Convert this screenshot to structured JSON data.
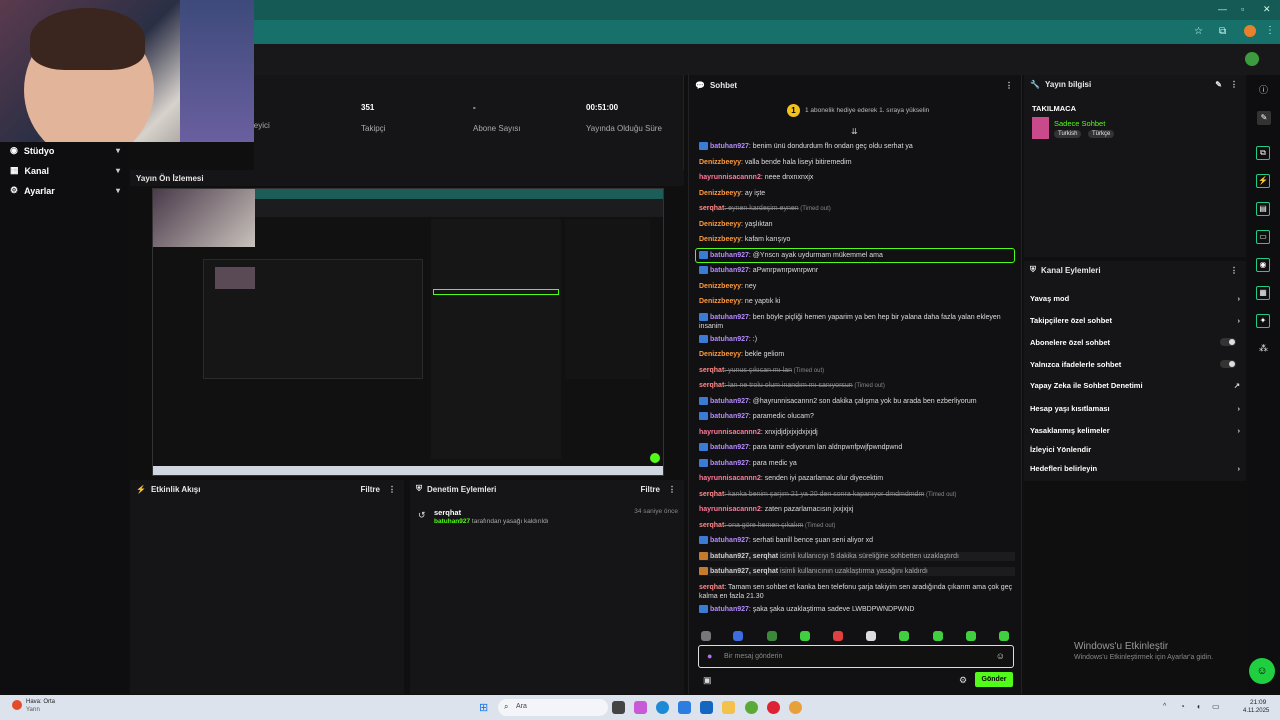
{
  "stats": [
    {
      "value": "351",
      "label": "Takipçi"
    },
    {
      "value": "-",
      "label": "Abone Sayısı"
    },
    {
      "value": "00:51:00",
      "label": "Yayında Olduğu Süre"
    }
  ],
  "stats_partial_label": "leyici",
  "nav": {
    "items": [
      "Stüdyo",
      "Kanal",
      "Ayarlar"
    ]
  },
  "preview": {
    "title": "Yayın Ön İzlemesi"
  },
  "activity": {
    "title": "Etkinlik Akışı",
    "filter": "Filtre"
  },
  "moderation": {
    "title": "Denetim Eylemleri",
    "filter": "Filtre",
    "entry": {
      "user": "serqhat",
      "actor": "batuhan927",
      "action": " tarafından yasağı kaldırıldı",
      "time": "34 saniye önce"
    }
  },
  "chat": {
    "title": "Sohbet",
    "banner": "1 abonelik hediye ederek 1. sıraya yükselin",
    "input_placeholder": "Bir mesaj gönderin",
    "send": "Gönder",
    "messages": [
      {
        "user": "batuhan927",
        "cls": "u1",
        "badge": true,
        "text": ": benim ünü dondurdum fln ondan geç oldu serhat ya"
      },
      {
        "user": "Denizzbeeyy",
        "cls": "u2",
        "text": ": valla bende hala liseyi bitiremedim"
      },
      {
        "user": "hayrunnisacannn2",
        "cls": "u3",
        "text": ": neee dnxnxnxjx"
      },
      {
        "user": "Denizzbeeyy",
        "cls": "u2",
        "text": ": ay işte"
      },
      {
        "user": "serqhat",
        "cls": "u4",
        "text": ": eynen kardeşim eynen",
        "strike": true,
        "timed": " (Timed out)"
      },
      {
        "user": "Denizzbeeyy",
        "cls": "u2",
        "text": ": yaşlıktan"
      },
      {
        "user": "Denizzbeeyy",
        "cls": "u2",
        "text": ": kafam karışıyo"
      },
      {
        "user": "batuhan927",
        "cls": "u1",
        "badge": true,
        "text": ": @Ynscn ayak uydurmam mükemmel ama",
        "highlight": true
      },
      {
        "user": "batuhan927",
        "cls": "u1",
        "badge": true,
        "text": ": aPwnrpwnrpwnrpwnr"
      },
      {
        "user": "Denizzbeeyy",
        "cls": "u2",
        "text": ": ney"
      },
      {
        "user": "Denizzbeeyy",
        "cls": "u2",
        "text": ": ne yaptık ki"
      },
      {
        "user": "batuhan927",
        "cls": "u1",
        "badge": true,
        "text": ": ben böyle piçliği hemen yaparim ya ben hep bir yalana daha fazla yalan ekleyen insanim",
        "two": true
      },
      {
        "user": "batuhan927",
        "cls": "u1",
        "badge": true,
        "text": ": :)"
      },
      {
        "user": "Denizzbeeyy",
        "cls": "u2",
        "text": ": bekle geliom"
      },
      {
        "user": "serqhat",
        "cls": "u4",
        "text": ": yunus çıkıcan mı lan",
        "strike": true,
        "timed": " (Timed out)"
      },
      {
        "user": "serqhat",
        "cls": "u4",
        "text": ": lan ne trolu olum inandım mı sanıyorsun",
        "strike": true,
        "timed": " (Timed out)"
      },
      {
        "user": "batuhan927",
        "cls": "u1",
        "badge": true,
        "text": ": @hayrunnisacannn2 son dakika çalışma yok bu arada ben ezberliyorum"
      },
      {
        "user": "batuhan927",
        "cls": "u1",
        "badge": true,
        "text": ": paramedic olucam?"
      },
      {
        "user": "hayrunnisacannn2",
        "cls": "u3",
        "text": ": xnxjdjdjxjxjdxjxjdj"
      },
      {
        "user": "batuhan927",
        "cls": "u1",
        "badge": true,
        "text": ": para tamir ediyorum lan aldnpwnfpwjfpwndpwnd"
      },
      {
        "user": "batuhan927",
        "cls": "u1",
        "badge": true,
        "text": ": para medic ya"
      },
      {
        "user": "hayrunnisacannn2",
        "cls": "u3",
        "text": ": senden iyi pazarlamac olur diyecektim"
      },
      {
        "user": "serqhat",
        "cls": "u4",
        "text": ": kanka benim şarjım 21 ya 20 den sonra kapanıyor dmdmdmdm",
        "strike": true,
        "timed": " (Timed out)"
      },
      {
        "user": "hayrunnisacannn2",
        "cls": "u3",
        "text": ": zaten pazarlamacısın jxxjxjxj"
      },
      {
        "user": "serqhat",
        "cls": "u4",
        "text": ": ona göre hemen çıkalım",
        "strike": true,
        "timed": " (Timed out)"
      },
      {
        "user": "batuhan927",
        "cls": "u1",
        "badge": true,
        "text": ": serhati banill bence şuan seni aliyor xd"
      },
      {
        "user": "batuhan927, serqhat",
        "cls": "u5",
        "text": " isimli kullanıcıyı 5 dakika süreliğine sohbetten uzaklaştırdı",
        "system": true
      },
      {
        "user": "batuhan927, serqhat",
        "cls": "u5",
        "text": " isimli kullanıcının uzaklaştırma yasağını kaldırdı",
        "system": true
      },
      {
        "user": "serqhat",
        "cls": "u4",
        "text": ": Tamam sen sohbet et kanka ben telefonu şarja takiyim sen aradığında çıkarım ama çok geç kalma en fazla 21.30",
        "two": true
      },
      {
        "user": "batuhan927",
        "cls": "u1",
        "badge": true,
        "text": ": şaka şaka uzaklaştirma sadeve LWBDPWNDPWND"
      }
    ]
  },
  "stream_info": {
    "title": "Yayın bilgisi",
    "stream_title": "TAKILMACA",
    "category": "Sadece Sohbet",
    "tags": [
      "Turkish",
      "Türkçe"
    ]
  },
  "channel_actions": {
    "title": "Kanal Eylemleri",
    "items": [
      {
        "label": "Yavaş mod",
        "kind": "arrow"
      },
      {
        "label": "Takipçilere özel sohbet",
        "kind": "arrow"
      },
      {
        "label": "Abonelere özel sohbet",
        "kind": "toggle"
      },
      {
        "label": "Yalnızca ifadelerle sohbet",
        "kind": "toggle"
      },
      {
        "label": "Yapay Zeka ile Sohbet Denetimi",
        "kind": "ext"
      },
      {
        "label": "Hesap yaşı kısıtlaması",
        "kind": "arrow"
      },
      {
        "label": "Yasaklanmış kelimeler",
        "kind": "arrow"
      },
      {
        "label": "İzleyici Yönlendir",
        "kind": "none"
      },
      {
        "label": "Hedefleri belirleyin",
        "kind": "arrow"
      }
    ]
  },
  "watermark": {
    "title": "Windows'u Etkinleştir",
    "subtitle": "Windows'u Etkinleştirmek için Ayarlar'a gidin."
  },
  "taskbar": {
    "weather_title": "Hava: Orta",
    "weather_sub": "Yarın",
    "search": "Ara",
    "time": "21:09",
    "date": "4.11.2025"
  },
  "colors": {
    "accent": "#53fc18",
    "brand_teal": "#17706a"
  }
}
